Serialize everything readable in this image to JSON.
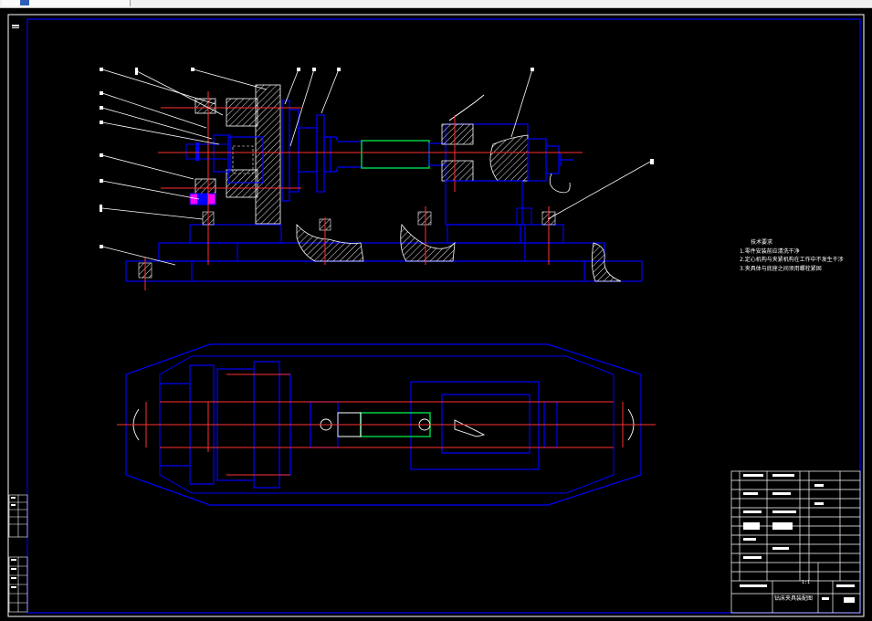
{
  "tech_requirements": {
    "heading": "技术要求",
    "items": [
      "1.零件安装前应清洗干净",
      "2.定心机构与夹紧机构在工作中不发生干涉",
      "3.夹具体与底座之间须用螺栓紧固"
    ]
  },
  "title_block": {
    "drawing_name": "钻床夹具装配图",
    "scale": "1:1"
  },
  "colors": {
    "frame": "#0000ff",
    "part_outline": "#0000ff",
    "center_line": "#ff3030",
    "hatch": "#ffffff",
    "workpiece": "#00c040",
    "text": "#ffffff",
    "cyan_accent": "#00ffff"
  }
}
